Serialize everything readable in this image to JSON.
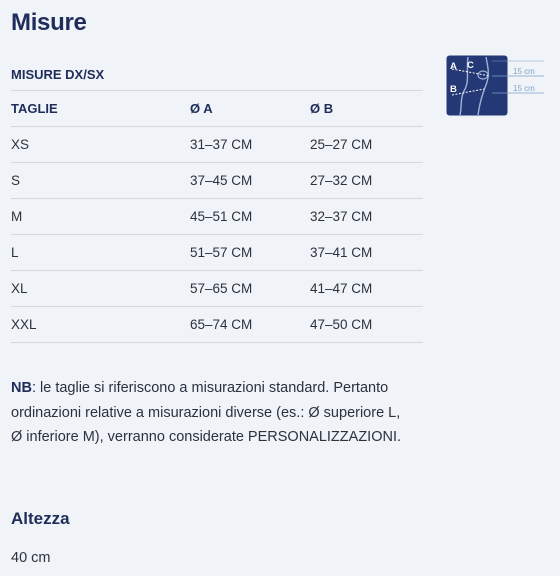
{
  "title": "Misure",
  "table": {
    "caption": "MISURE DX/SX",
    "headers": [
      "TAGLIE",
      "Ø A",
      "Ø B"
    ],
    "rows": [
      [
        "XS",
        "31–37 CM",
        "25–27 CM"
      ],
      [
        "S",
        "37–45 CM",
        "27–32 CM"
      ],
      [
        "M",
        "45–51 CM",
        "32–37 CM"
      ],
      [
        "L",
        "51–57 CM",
        "37–41 CM"
      ],
      [
        "XL",
        "57–65 CM",
        "41–47 CM"
      ],
      [
        "XXL",
        "65–74 CM",
        "47–50 CM"
      ]
    ]
  },
  "diagram": {
    "label_a": "A",
    "label_b": "B",
    "label_c": "C",
    "measure_top": "15 cm",
    "measure_bottom": "15 cm",
    "color": "#233875"
  },
  "note": {
    "prefix": "NB",
    "text": ":  le taglie si riferiscono a misurazioni standard. Pertanto ordinazioni relative a misurazioni diverse (es.: Ø superiore L, Ø inferiore M), verranno considerate PERSONALIZZAZIONI."
  },
  "height": {
    "title": "Altezza",
    "value": "40 cm"
  }
}
